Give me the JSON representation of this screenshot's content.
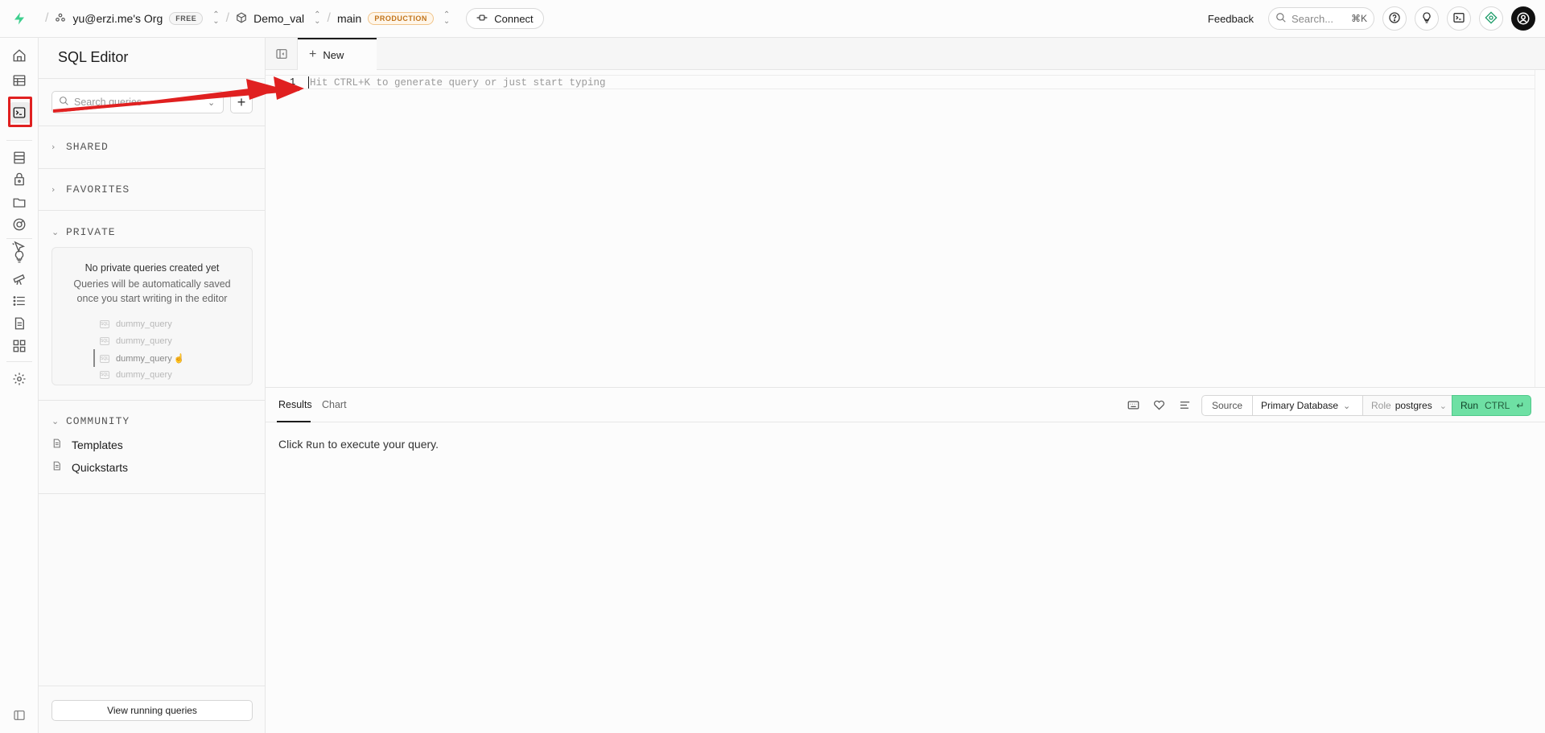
{
  "topbar": {
    "org_name": "yu@erzi.me's Org",
    "org_badge": "FREE",
    "project_name": "Demo_val",
    "branch_name": "main",
    "branch_badge": "PRODUCTION",
    "connect_label": "Connect",
    "feedback_label": "Feedback",
    "search_placeholder": "Search...",
    "search_shortcut": "⌘K"
  },
  "sidebar": {
    "title": "SQL Editor",
    "search_placeholder": "Search queries",
    "sections": {
      "shared": "SHARED",
      "favorites": "FAVORITES",
      "private": "PRIVATE",
      "community": "COMMUNITY"
    },
    "empty_state": {
      "title": "No private queries created yet",
      "description": "Queries will be automatically saved once you start writing in the editor",
      "dummy_items": [
        "dummy_query",
        "dummy_query",
        "dummy_query",
        "dummy_query"
      ]
    },
    "community_items": [
      "Templates",
      "Quickstarts"
    ],
    "view_running_label": "View running queries"
  },
  "editor": {
    "tab_label": "New",
    "line_number": "1",
    "placeholder": "Hit CTRL+K to generate query or just start typing"
  },
  "results": {
    "tabs": [
      "Results",
      "Chart"
    ],
    "source_label": "Source",
    "database_label": "Primary Database",
    "role_label": "Role",
    "role_value": "postgres",
    "run_label": "Run",
    "run_shortcut": "CTRL",
    "message_prefix": "Click",
    "message_run": "Run",
    "message_suffix": "to execute your query."
  },
  "colors": {
    "brand_green": "#3ecf8e",
    "run_button": "#6ee0a4",
    "production_badge": "#c2741a",
    "annotation_red": "#e02020"
  }
}
